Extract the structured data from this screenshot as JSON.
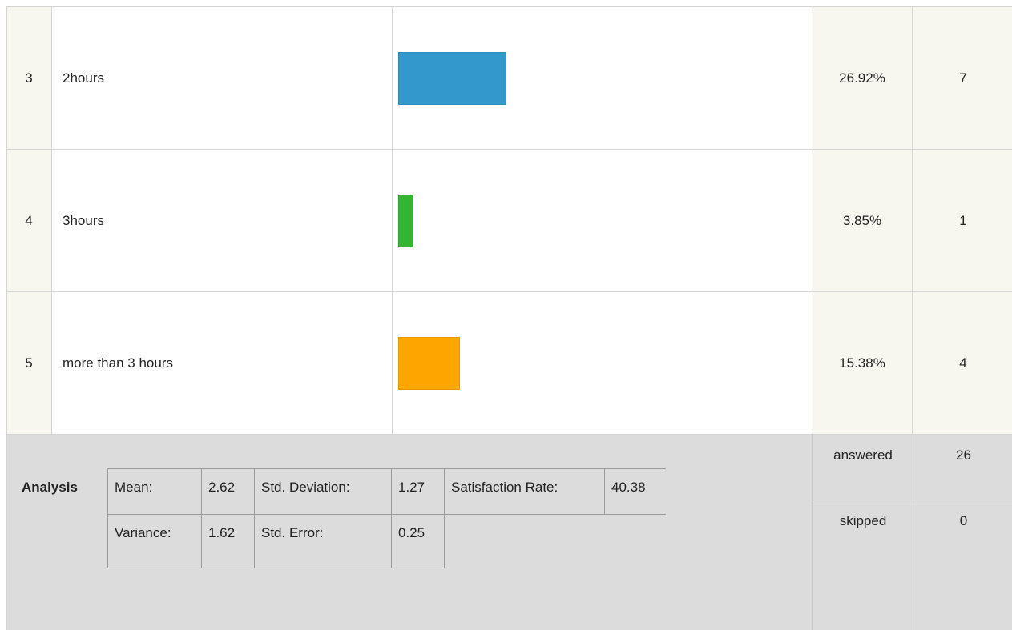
{
  "rows": [
    {
      "index": "3",
      "label": "2hours",
      "percent": "26.92%",
      "count": "7",
      "fraction": 0.2692,
      "color": "#3399cc"
    },
    {
      "index": "4",
      "label": "3hours",
      "percent": "3.85%",
      "count": "1",
      "fraction": 0.0385,
      "color": "#33b533"
    },
    {
      "index": "5",
      "label": "more than 3 hours",
      "percent": "15.38%",
      "count": "4",
      "fraction": 0.1538,
      "color": "#ffa500"
    }
  ],
  "analysis": {
    "title": "Analysis",
    "mean_label": "Mean:",
    "mean_value": "2.62",
    "std_dev_label": "Std. Deviation:",
    "std_dev_value": "1.27",
    "satisfaction_label": "Satisfaction Rate:",
    "satisfaction_value": "40.38",
    "variance_label": "Variance:",
    "variance_value": "1.62",
    "std_error_label": "Std. Error:",
    "std_error_value": "0.25"
  },
  "summary": {
    "answered_label": "answered",
    "answered_value": "26",
    "skipped_label": "skipped",
    "skipped_value": "0"
  }
}
